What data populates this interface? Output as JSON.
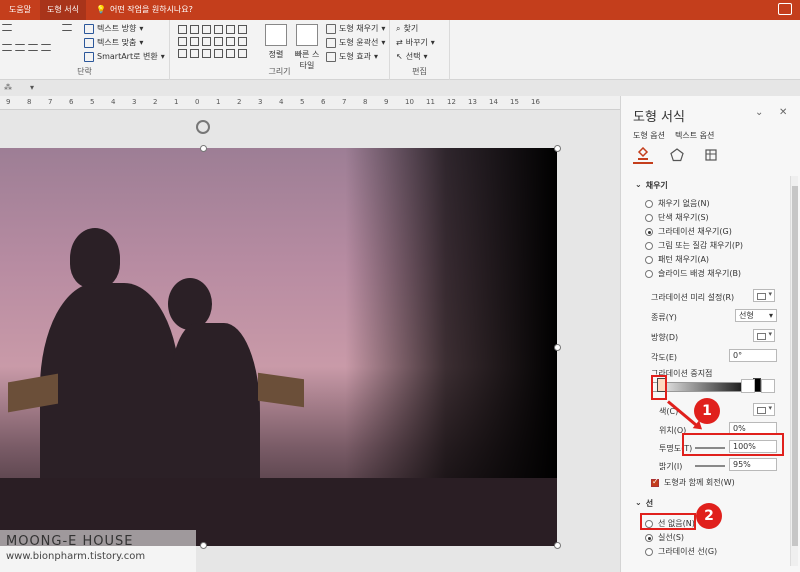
{
  "tabbar": {
    "tabs": [
      "도움말",
      "도형 서식"
    ],
    "tell_me": "어떤 작업을 원하시나요?"
  },
  "ribbon": {
    "text_direction": "텍스트 방향",
    "text_align": "텍스트 맞춤",
    "smartart": "SmartArt로 변환",
    "paragraph_group": "단락",
    "arrange": "정렬",
    "quick_styles": "빠른 스타일",
    "shape_fill": "도형 채우기",
    "shape_outline": "도형 윤곽선",
    "shape_effects": "도형 효과",
    "drawing_group": "그리기",
    "find": "찾기",
    "replace": "바꾸기",
    "select": "선택",
    "editing_group": "편집"
  },
  "ruler": {
    "ticks": [
      "9",
      "8",
      "7",
      "6",
      "5",
      "4",
      "3",
      "2",
      "1",
      "0",
      "1",
      "2",
      "3",
      "4",
      "5",
      "6",
      "7",
      "8",
      "9",
      "10",
      "11",
      "12",
      "13",
      "14",
      "15",
      "16"
    ]
  },
  "watermark": {
    "title": "MOONG-E HOUSE",
    "url": "www.bionpharm.tistory.com"
  },
  "pane": {
    "title": "도형 서식",
    "tabs": [
      "도형 옵션",
      "텍스트 옵션"
    ],
    "fill_section": "채우기",
    "fill_options": [
      {
        "label": "채우기 없음(N)",
        "checked": false
      },
      {
        "label": "단색 채우기(S)",
        "checked": false
      },
      {
        "label": "그라데이션 채우기(G)",
        "checked": true
      },
      {
        "label": "그림 또는 질감 채우기(P)",
        "checked": false
      },
      {
        "label": "패턴 채우기(A)",
        "checked": false
      },
      {
        "label": "슬라이드 배경 채우기(B)",
        "checked": false
      }
    ],
    "preset_label": "그라데이션 미리 설정(R)",
    "type_label": "종류(Y)",
    "type_value": "선형",
    "direction_label": "방향(D)",
    "angle_label": "각도(E)",
    "angle_value": "0°",
    "stops_label": "그라데이션 중지점",
    "color_label": "색(C)",
    "position_label": "위치(O)",
    "position_value": "0%",
    "transparency_label": "투명도(T)",
    "transparency_value": "100%",
    "brightness_label": "밝기(I)",
    "brightness_value": "95%",
    "rotate_label": "도형과 함께 회전(W)",
    "line_section": "선",
    "line_options": [
      {
        "label": "선 없음(N)",
        "checked": false
      },
      {
        "label": "실선(S)",
        "checked": true
      },
      {
        "label": "그라데이션 선(G)",
        "checked": false
      }
    ]
  },
  "callouts": [
    "1",
    "2"
  ],
  "colors": {
    "accent": "#c43e1c",
    "highlight": "#e0201c"
  }
}
